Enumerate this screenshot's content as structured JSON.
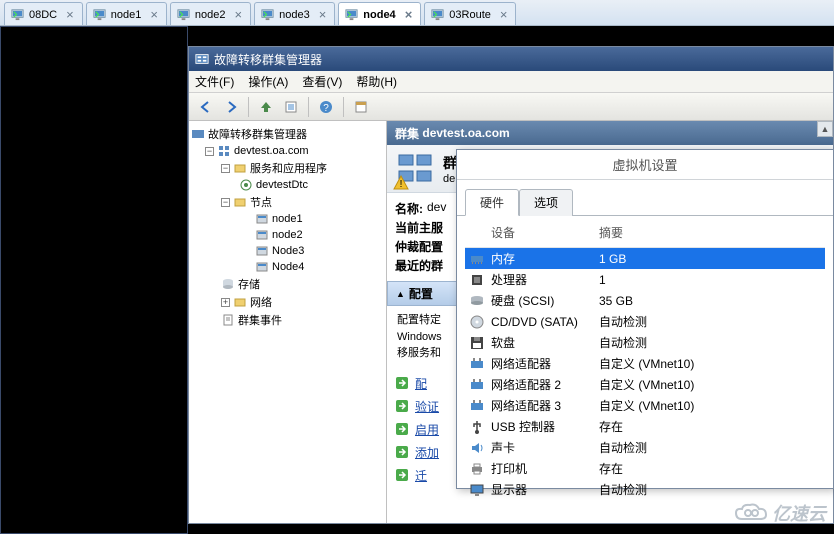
{
  "tabs": [
    {
      "label": "08DC"
    },
    {
      "label": "node1"
    },
    {
      "label": "node2"
    },
    {
      "label": "node3"
    },
    {
      "label": "node4",
      "active": true
    },
    {
      "label": "03Route"
    }
  ],
  "cluster": {
    "title": "故障转移群集管理器",
    "menu": {
      "file": "文件(F)",
      "action": "操作(A)",
      "view": "查看(V)",
      "help": "帮助(H)"
    },
    "tree": {
      "root": "故障转移群集管理器",
      "domain": "devtest.oa.com",
      "services": "服务和应用程序",
      "dtc": "devtestDtc",
      "nodes": "节点",
      "node_items": [
        "node1",
        "node2",
        "Node3",
        "Node4"
      ],
      "storage": "存储",
      "network": "网络",
      "events": "群集事件"
    },
    "detail": {
      "header_prefix": "群集",
      "header_domain": "devtest.oa.com",
      "banner_title": "群",
      "banner_sub": "de",
      "fields": {
        "name_k": "名称:",
        "name_v": "dev",
        "host_k": "当前主服",
        "quorum_k": "仲裁配置",
        "recent_k": "最近的群"
      },
      "section_config": "配置",
      "config_text1": "配置特定",
      "config_text2": "Windows",
      "config_text3": "移服务和",
      "links": [
        "配",
        "验证",
        "启用",
        "添加",
        "迁"
      ]
    }
  },
  "vm": {
    "title": "虚拟机设置",
    "tabs": {
      "hardware": "硬件",
      "options": "选项"
    },
    "cols": {
      "device": "设备",
      "summary": "摘要"
    },
    "devices": [
      {
        "icon": "memory",
        "name": "内存",
        "summary": "1 GB",
        "sel": true
      },
      {
        "icon": "cpu",
        "name": "处理器",
        "summary": "1"
      },
      {
        "icon": "hdd",
        "name": "硬盘 (SCSI)",
        "summary": "35 GB"
      },
      {
        "icon": "cd",
        "name": "CD/DVD (SATA)",
        "summary": "自动检测"
      },
      {
        "icon": "floppy",
        "name": "软盘",
        "summary": "自动检测"
      },
      {
        "icon": "nic",
        "name": "网络适配器",
        "summary": "自定义 (VMnet10)"
      },
      {
        "icon": "nic",
        "name": "网络适配器 2",
        "summary": "自定义 (VMnet10)"
      },
      {
        "icon": "nic",
        "name": "网络适配器 3",
        "summary": "自定义 (VMnet10)"
      },
      {
        "icon": "usb",
        "name": "USB 控制器",
        "summary": "存在"
      },
      {
        "icon": "sound",
        "name": "声卡",
        "summary": "自动检测"
      },
      {
        "icon": "printer",
        "name": "打印机",
        "summary": "存在"
      },
      {
        "icon": "display",
        "name": "显示器",
        "summary": "自动检测"
      }
    ]
  },
  "watermark": "亿速云"
}
